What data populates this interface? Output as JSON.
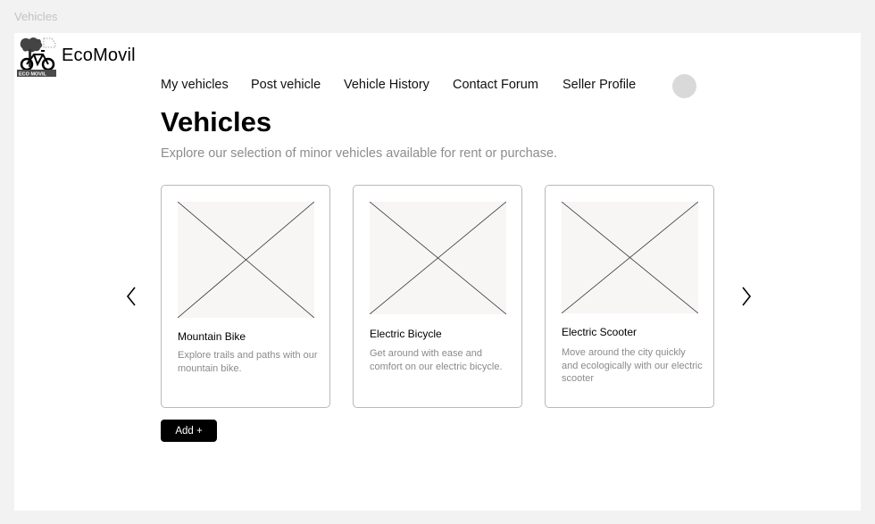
{
  "frame": {
    "label": "Vehicles"
  },
  "brand": {
    "name": "EcoMovil",
    "badge_text": "ECO MOVIL"
  },
  "nav": {
    "items": [
      {
        "label": "My vehicles"
      },
      {
        "label": "Post vehicle"
      },
      {
        "label": "Vehicle History"
      },
      {
        "label": "Contact Forum"
      },
      {
        "label": "Seller Profile"
      }
    ]
  },
  "page": {
    "title": "Vehicles",
    "subtitle": "Explore our selection of minor vehicles available for rent or purchase."
  },
  "carousel": {
    "prev_icon": "chevron-left-icon",
    "next_icon": "chevron-right-icon",
    "cards": [
      {
        "name": "Mountain Bike",
        "description": "Explore trails and paths with our mountain bike."
      },
      {
        "name": "Electric Bicycle",
        "description": "Get around with ease and comfort on our electric bicycle."
      },
      {
        "name": "Electric Scooter",
        "description": "Move around the city quickly and ecologically with our electric scooter"
      }
    ]
  },
  "actions": {
    "add_label": "Add +"
  },
  "colors": {
    "frame_bg": "#ffffff",
    "page_bg": "#f2f2f2",
    "placeholder_bg": "#f8f5f5",
    "button_bg": "#000000",
    "muted_text": "#8a8a8a"
  }
}
